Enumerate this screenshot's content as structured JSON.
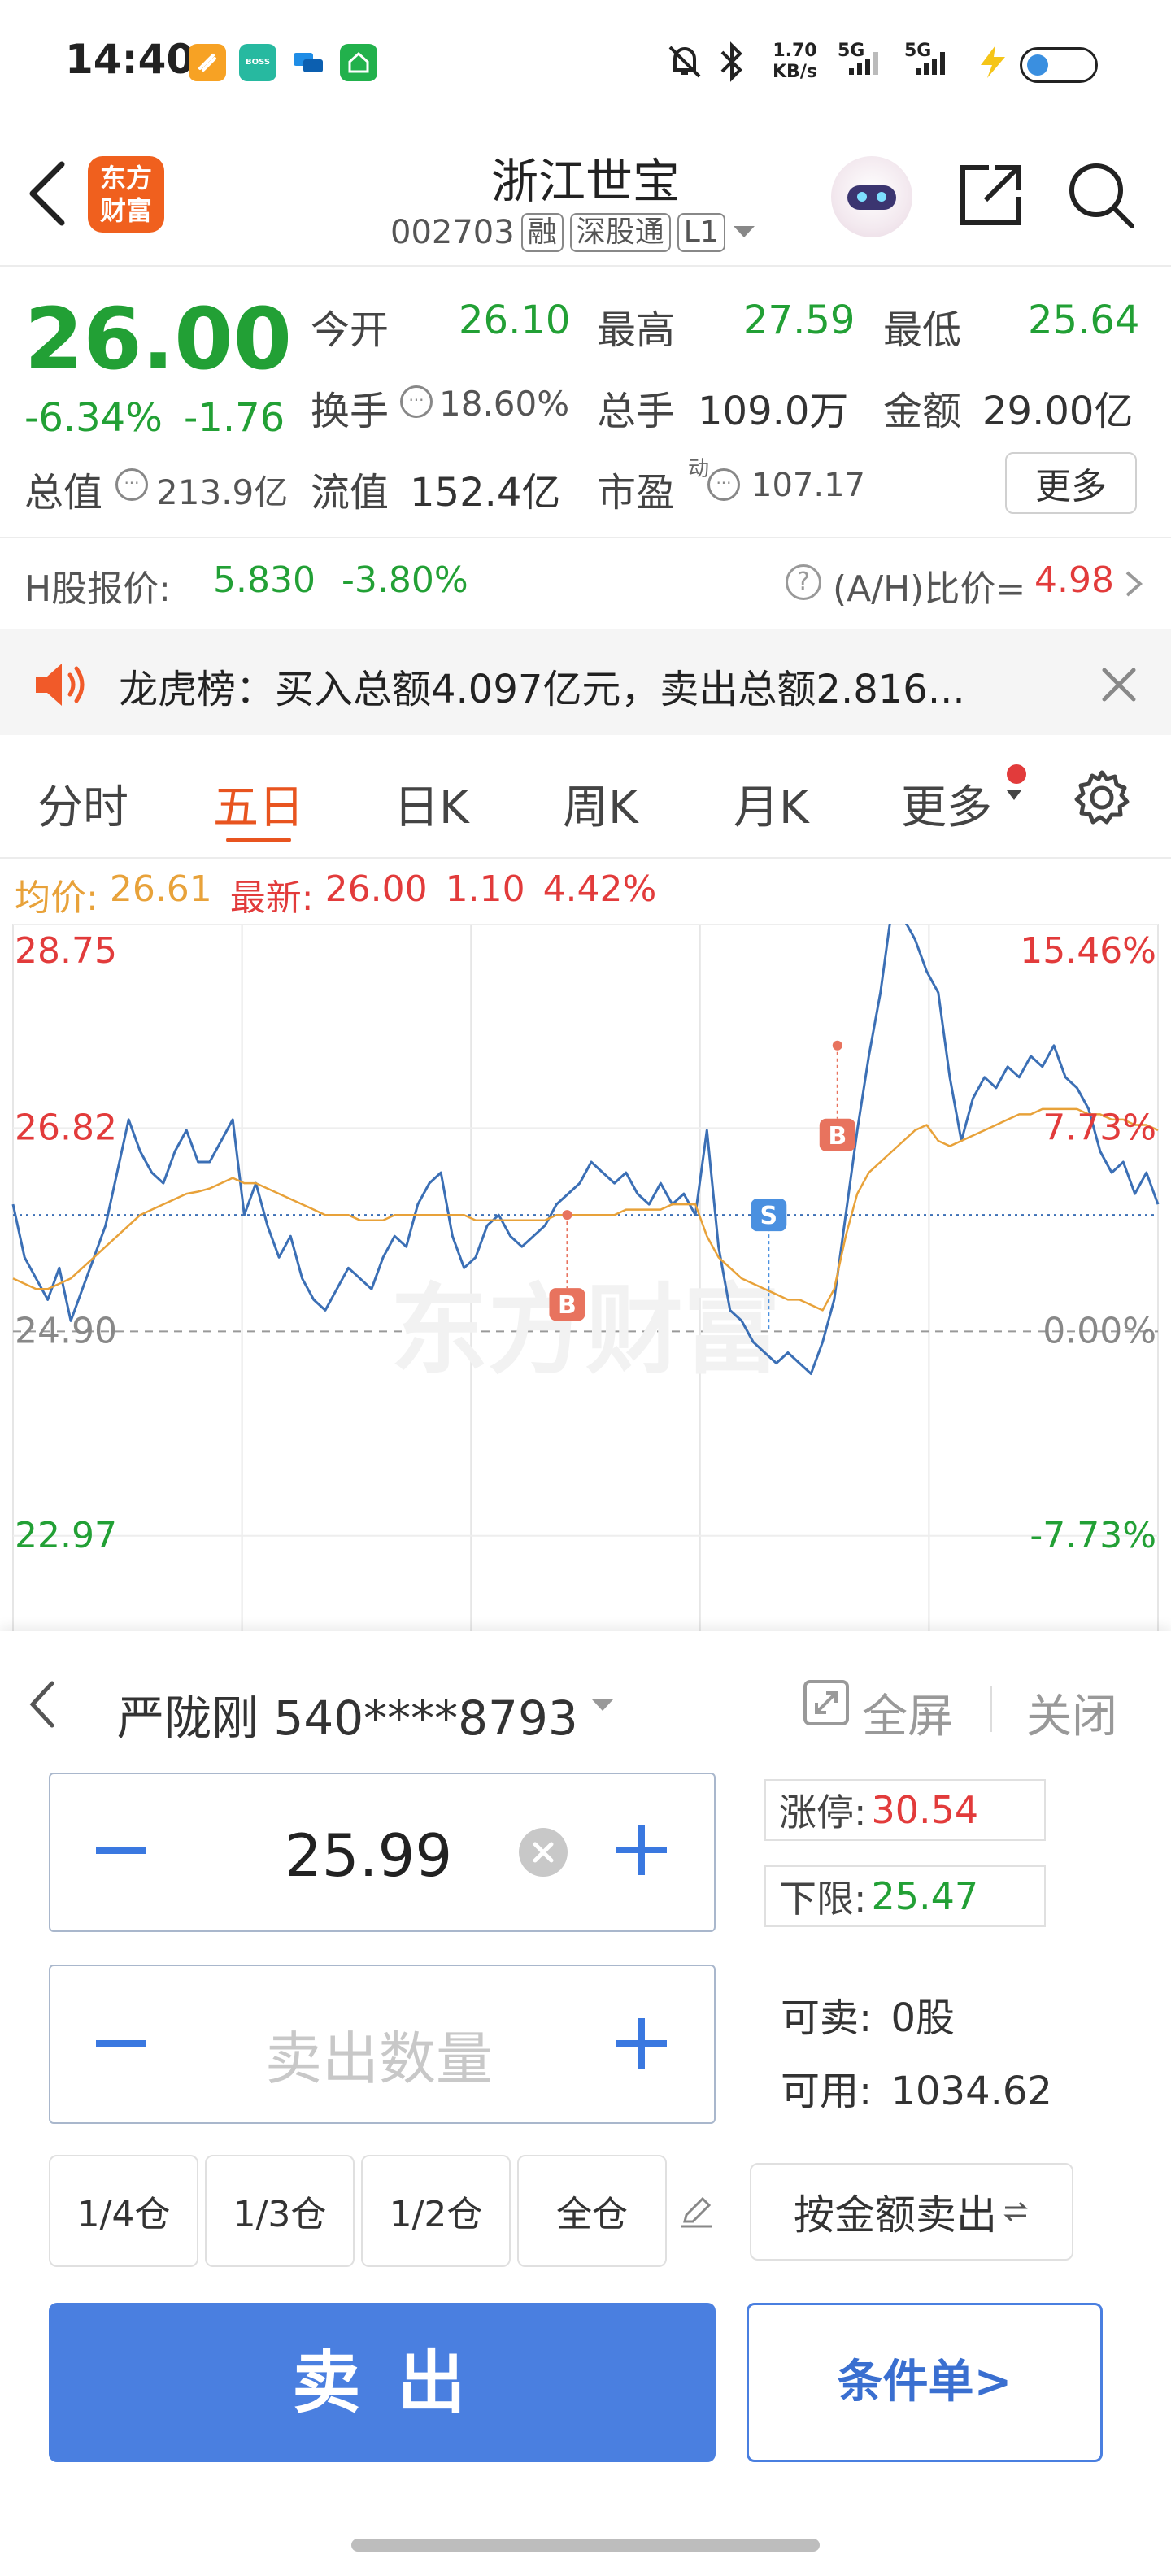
{
  "status_bar": {
    "time": "14:40",
    "net_speed_top": "1.70",
    "net_speed_bottom": "KB/s",
    "sig1": "5G",
    "sig2": "5G",
    "app_icon_boss_label": "BOSS\n直聘"
  },
  "header": {
    "title": "浙江世宝",
    "code": "002703",
    "tag1": "融",
    "tag2": "深股通",
    "tag3": "L1",
    "logo_line1": "东方",
    "logo_line2": "财富"
  },
  "quote": {
    "price": "26.00",
    "change_pct": "-6.34%",
    "change_val": "-1.76",
    "open_label": "今开",
    "open": "26.10",
    "high_label": "最高",
    "high": "27.59",
    "low_label": "最低",
    "low": "25.64",
    "turnover_label": "换手",
    "turnover": "18.60%",
    "volume_label": "总手",
    "volume": "109.0万",
    "amount_label": "金额",
    "amount": "29.00亿",
    "mcap_label": "总值",
    "mcap": "213.9亿",
    "float_label": "流值",
    "float": "152.4亿",
    "pe_label": "市盈",
    "pe_sup": "动",
    "pe": "107.17",
    "more_button": "更多"
  },
  "h_share": {
    "label": "H股报价:",
    "price": "5.830",
    "pct": "-3.80%",
    "ratio_label": "(A/H)比价=",
    "ratio": "4.98"
  },
  "news": {
    "text": "龙虎榜：买入总额4.097亿元，卖出总额2.816..."
  },
  "tabs": [
    "分时",
    "五日",
    "日K",
    "周K",
    "月K",
    "更多"
  ],
  "active_tab": "五日",
  "chart_info": {
    "avg_label": "均价:",
    "avg": "26.61",
    "last_label": "最新:",
    "last": "26.00",
    "chg": "1.10",
    "pct": "4.42%"
  },
  "chart_data": {
    "type": "line",
    "y_left_labels": [
      "28.75",
      "26.82",
      "24.90",
      "22.97"
    ],
    "y_right_labels": [
      "15.46%",
      "7.73%",
      "0.00%",
      "-7.73%"
    ],
    "ylim": [
      22.07,
      28.75
    ],
    "prev_close": 24.9,
    "days": 5,
    "series": [
      {
        "values": [
          26.1,
          25.6,
          25.4,
          25.2,
          25.5,
          25.0,
          25.3,
          25.6,
          25.9,
          26.4,
          26.9,
          26.6,
          26.4,
          26.3,
          26.6,
          26.8,
          26.5,
          26.5,
          26.7,
          26.9,
          26.0,
          26.3,
          25.9,
          25.6,
          25.8,
          25.4,
          25.2,
          25.1,
          25.3,
          25.5,
          25.4,
          25.3,
          25.6,
          25.8,
          25.7,
          26.1,
          26.3,
          26.4,
          25.8,
          25.5,
          25.6,
          25.9,
          26.0,
          25.8,
          25.7,
          25.8,
          25.9,
          26.1,
          26.2,
          26.3,
          26.5,
          26.4,
          26.3,
          26.4,
          26.2,
          26.1,
          26.3,
          26.1,
          26.2,
          26.0,
          26.8,
          25.7,
          25.1,
          25.0,
          24.8,
          24.7,
          24.6,
          24.7,
          24.6,
          24.5,
          24.8,
          25.2,
          26.0,
          26.8,
          27.5,
          28.1,
          28.9,
          28.8,
          28.6,
          28.3,
          28.1,
          27.3,
          26.7,
          27.1,
          27.3,
          27.2,
          27.4,
          27.3,
          27.5,
          27.4,
          27.6,
          27.3,
          27.2,
          27.0,
          26.6,
          26.4,
          26.5,
          26.2,
          26.4,
          26.1
        ]
      },
      {
        "values": [
          25.4,
          25.35,
          25.3,
          25.3,
          25.35,
          25.4,
          25.5,
          25.6,
          25.7,
          25.8,
          25.9,
          26.0,
          26.05,
          26.1,
          26.15,
          26.2,
          26.22,
          26.25,
          26.3,
          26.35,
          26.3,
          26.3,
          26.25,
          26.2,
          26.15,
          26.1,
          26.05,
          26.0,
          26.0,
          26.0,
          25.95,
          25.95,
          25.95,
          26.0,
          26.0,
          26.0,
          26.0,
          26.0,
          26.0,
          26.0,
          25.95,
          25.95,
          25.95,
          25.95,
          25.95,
          25.95,
          25.95,
          26.0,
          26.0,
          26.0,
          26.0,
          26.0,
          26.0,
          26.05,
          26.05,
          26.05,
          26.05,
          26.1,
          26.1,
          26.1,
          25.8,
          25.6,
          25.5,
          25.4,
          25.35,
          25.3,
          25.25,
          25.2,
          25.2,
          25.15,
          25.1,
          25.3,
          25.8,
          26.2,
          26.4,
          26.5,
          26.6,
          26.7,
          26.8,
          26.85,
          26.7,
          26.65,
          26.7,
          26.75,
          26.8,
          26.85,
          26.9,
          26.95,
          26.95,
          27.0,
          27.0,
          27.0,
          27.0,
          26.95,
          26.95,
          26.9,
          26.9,
          26.85,
          26.85,
          26.8
        ]
      }
    ],
    "markers": [
      {
        "label": "B",
        "day": 2,
        "value": 26.0
      },
      {
        "label": "S",
        "day": 3,
        "value": 26.0
      },
      {
        "label": "B",
        "day": 3,
        "value": 27.6
      }
    ],
    "watermark": "东方财富"
  },
  "trade": {
    "account": "严陇刚 540****8793",
    "fullscreen": "全屏",
    "close": "关闭",
    "price_value": "25.99",
    "qty_placeholder": "卖出数量",
    "limit_up_label": "涨停:",
    "limit_up": "30.54",
    "limit_down_label": "下限:",
    "limit_down": "25.47",
    "sellable_label": "可卖:",
    "sellable": "0股",
    "available_label": "可用:",
    "available": "1034.62",
    "pos_buttons": [
      "1/4仓",
      "1/3仓",
      "1/2仓",
      "全仓"
    ],
    "amount_sell": "按金额卖出",
    "sell_button": "卖 出",
    "condition_button": "条件单>"
  },
  "colors": {
    "up": "#e23b3b",
    "down": "#22a035",
    "accent": "#3a78e0",
    "avg_line": "#e8a23a",
    "price_line": "#3b6fb5"
  }
}
